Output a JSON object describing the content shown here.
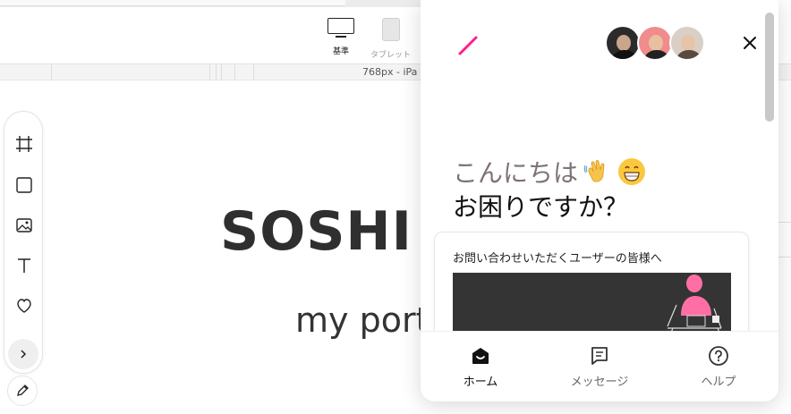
{
  "toolbar": {
    "device_desktop_label": "基準",
    "device_tablet_label": "タブレット",
    "ruler_label": "768px - iPa"
  },
  "canvas": {
    "hero_title": "SOSHI K",
    "hero_subtitle": "my port"
  },
  "left_tools": {
    "icons": [
      "frame-icon",
      "rectangle-icon",
      "image-icon",
      "text-icon",
      "heart-icon",
      "chevron-right-icon",
      "pencil-icon"
    ]
  },
  "chat_widget": {
    "greeting_line1": "こんにちは",
    "greeting_line2": "お困りですか？",
    "card_title": "お問い合わせいただくユーザーの皆様へ",
    "nav": {
      "home": "ホーム",
      "messages": "メッセージ",
      "help": "ヘルプ"
    },
    "colors": {
      "accent": "#ff1e8c",
      "greeting_muted": "#7e7374",
      "card_image_bg": "#343434"
    }
  }
}
